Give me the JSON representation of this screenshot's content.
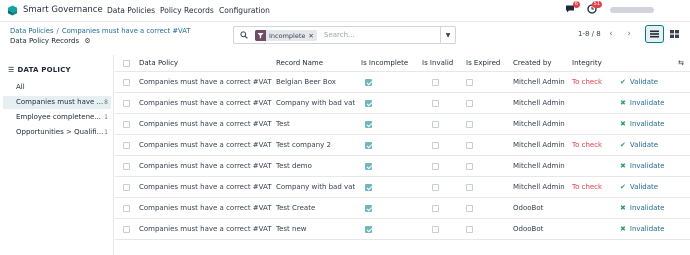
{
  "navbar": {
    "app_name": "Smart Governance",
    "menus": [
      "Data Policies",
      "Policy Records",
      "Configuration"
    ],
    "messages_count": "6",
    "activities_count": "51"
  },
  "breadcrumb": {
    "root": "Data Policies",
    "parent": "Companies must have a correct #VAT",
    "current": "Data Policy Records"
  },
  "search": {
    "facet_label": "Incomplete",
    "placeholder": "Search..."
  },
  "pager": {
    "value": "1-8 / 8"
  },
  "sidebar": {
    "title": "DATA POLICY",
    "items": [
      {
        "label": "All",
        "count": ""
      },
      {
        "label": "Companies must have ...",
        "count": "8"
      },
      {
        "label": "Employee completene...",
        "count": "1"
      },
      {
        "label": "Opportunities > Qualifi...",
        "count": "1"
      }
    ]
  },
  "table": {
    "headers": [
      "Data Policy",
      "Record Name",
      "Is Incomplete",
      "Is Invalid",
      "Is Expired",
      "Created by",
      "Integrity"
    ],
    "rows": [
      {
        "policy": "Companies must have a correct #VAT",
        "record": "Belgian Beer Box",
        "incomplete": true,
        "invalid": false,
        "expired": false,
        "created_by": "Mitchell Admin",
        "integrity": "To check",
        "action": "Validate",
        "action_icon": "check"
      },
      {
        "policy": "Companies must have a correct #VAT",
        "record": "Company with bad vat",
        "incomplete": true,
        "invalid": false,
        "expired": false,
        "created_by": "Mitchell Admin",
        "integrity": "",
        "action": "Invalidate",
        "action_icon": "x"
      },
      {
        "policy": "Companies must have a correct #VAT",
        "record": "Test",
        "incomplete": true,
        "invalid": false,
        "expired": false,
        "created_by": "Mitchell Admin",
        "integrity": "",
        "action": "Invalidate",
        "action_icon": "x"
      },
      {
        "policy": "Companies must have a correct #VAT",
        "record": "Test company 2",
        "incomplete": true,
        "invalid": false,
        "expired": false,
        "created_by": "Mitchell Admin",
        "integrity": "To check",
        "action": "Validate",
        "action_icon": "check"
      },
      {
        "policy": "Companies must have a correct #VAT",
        "record": "Test demo",
        "incomplete": true,
        "invalid": false,
        "expired": false,
        "created_by": "Mitchell Admin",
        "integrity": "",
        "action": "Invalidate",
        "action_icon": "x"
      },
      {
        "policy": "Companies must have a correct #VAT",
        "record": "Company with bad vat",
        "incomplete": true,
        "invalid": false,
        "expired": false,
        "created_by": "Mitchell Admin",
        "integrity": "To check",
        "action": "Validate",
        "action_icon": "check"
      },
      {
        "policy": "Companies must have a correct #VAT",
        "record": "Test Create",
        "incomplete": true,
        "invalid": false,
        "expired": false,
        "created_by": "OdooBot",
        "integrity": "",
        "action": "Invalidate",
        "action_icon": "x"
      },
      {
        "policy": "Companies must have a correct #VAT",
        "record": "Test new",
        "incomplete": true,
        "invalid": false,
        "expired": false,
        "created_by": "OdooBot",
        "integrity": "",
        "action": "Invalidate",
        "action_icon": "x"
      }
    ]
  },
  "colors": {
    "brand": "#714b67",
    "accent": "#017e84",
    "danger": "#e0424b",
    "success": "#2f9e64",
    "link": "#1f6a8f"
  }
}
